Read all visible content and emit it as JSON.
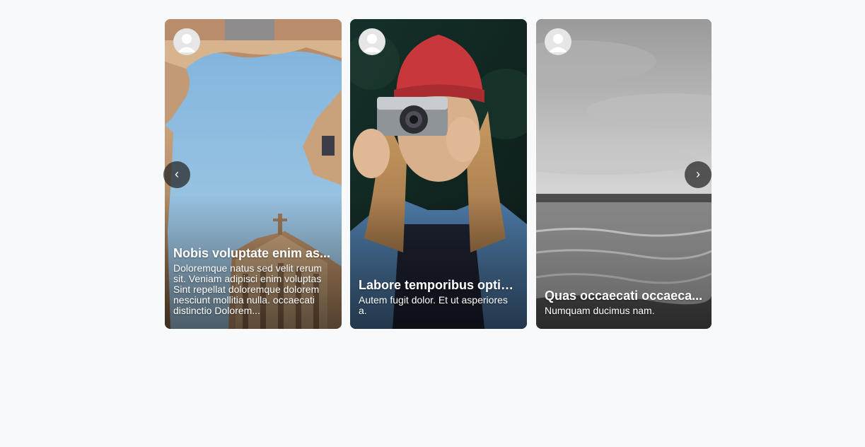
{
  "cards": [
    {
      "title": "Nobis voluptate enim as...",
      "text": "Doloremque natus sed velit rerum sit. Veniam adipisci enim voluptas Sint repellat doloremque dolorem nesciunt mollitia nulla. occaecati distinctio Dolorem...",
      "image": "low-angle-baroque-courtyard-blue-sky"
    },
    {
      "title": "Labore temporibus optio...",
      "text": "Autem fugit dolor. Et ut asperiores a.",
      "image": "woman-red-beanie-holding-camera"
    },
    {
      "title": "Quas occaecati occaeca...",
      "text": "Numquam ducimus nam.",
      "image": "black-and-white-seashore-cloudy-sky"
    }
  ],
  "nav": {
    "prev_icon": "‹",
    "next_icon": "›"
  },
  "colors": {
    "page_background": "#f8f9fa",
    "nav_button": "#282828"
  }
}
